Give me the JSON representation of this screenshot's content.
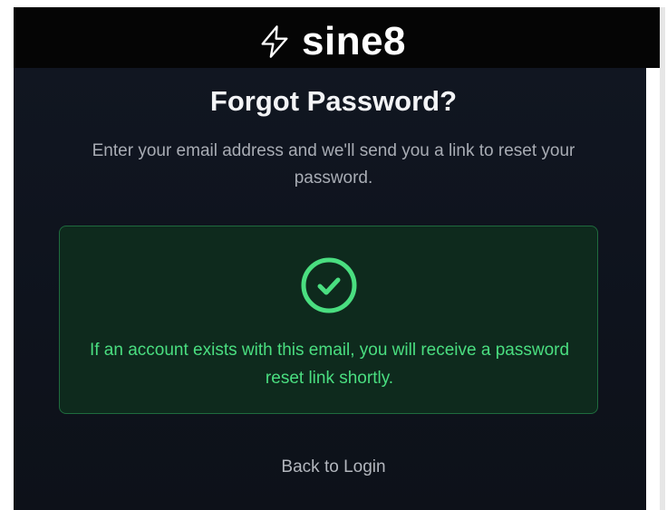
{
  "brand": {
    "name": "sine8",
    "icon": "lightning-bolt-icon"
  },
  "page": {
    "title": "Forgot Password?",
    "subtitle": "Enter your email address and we'll send you a link to reset your password."
  },
  "success": {
    "icon": "check-circle-icon",
    "message": "If an account exists with this email, you will receive a password reset link shortly.",
    "color": "#4ade80"
  },
  "links": {
    "back_to_login": "Back to Login"
  },
  "colors": {
    "background": "#0e131d",
    "header": "#050505",
    "success_bg": "#0e2a1d",
    "success_border": "#1f6b3e"
  }
}
